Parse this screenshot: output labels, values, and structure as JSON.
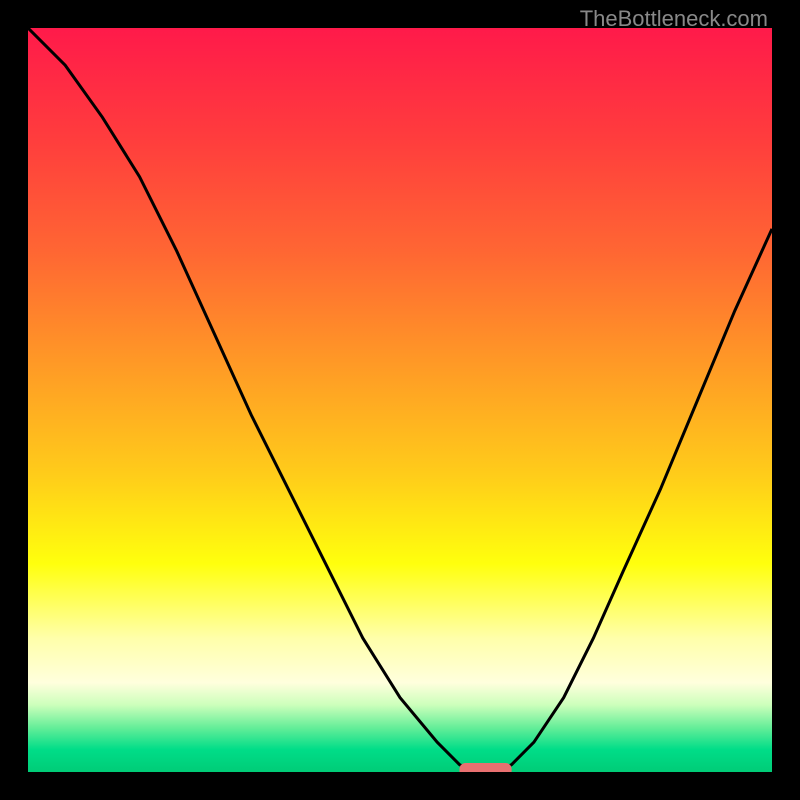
{
  "watermark": "TheBottleneck.com",
  "chart_data": {
    "type": "line",
    "title": "",
    "xlabel": "",
    "ylabel": "",
    "xlim": [
      0,
      100
    ],
    "ylim": [
      0,
      100
    ],
    "curve_points": [
      {
        "x": 0,
        "y": 100
      },
      {
        "x": 5,
        "y": 95
      },
      {
        "x": 10,
        "y": 88
      },
      {
        "x": 15,
        "y": 80
      },
      {
        "x": 20,
        "y": 70
      },
      {
        "x": 25,
        "y": 59
      },
      {
        "x": 30,
        "y": 48
      },
      {
        "x": 35,
        "y": 38
      },
      {
        "x": 40,
        "y": 28
      },
      {
        "x": 45,
        "y": 18
      },
      {
        "x": 50,
        "y": 10
      },
      {
        "x": 55,
        "y": 4
      },
      {
        "x": 58,
        "y": 1
      },
      {
        "x": 60,
        "y": 0
      },
      {
        "x": 63,
        "y": 0
      },
      {
        "x": 65,
        "y": 1
      },
      {
        "x": 68,
        "y": 4
      },
      {
        "x": 72,
        "y": 10
      },
      {
        "x": 76,
        "y": 18
      },
      {
        "x": 80,
        "y": 27
      },
      {
        "x": 85,
        "y": 38
      },
      {
        "x": 90,
        "y": 50
      },
      {
        "x": 95,
        "y": 62
      },
      {
        "x": 100,
        "y": 73
      }
    ],
    "marker": {
      "x_start": 58,
      "x_end": 65,
      "y": 0,
      "color": "#e87070"
    },
    "gradient_stops": [
      {
        "offset": 0,
        "color": "#ff1a4a"
      },
      {
        "offset": 15,
        "color": "#ff3d3d"
      },
      {
        "offset": 30,
        "color": "#ff6633"
      },
      {
        "offset": 45,
        "color": "#ff9926"
      },
      {
        "offset": 60,
        "color": "#ffcc1a"
      },
      {
        "offset": 72,
        "color": "#ffff0d"
      },
      {
        "offset": 82,
        "color": "#ffffaa"
      },
      {
        "offset": 88,
        "color": "#ffffdd"
      },
      {
        "offset": 91,
        "color": "#ccffbb"
      },
      {
        "offset": 94,
        "color": "#66ee99"
      },
      {
        "offset": 97,
        "color": "#00dd88"
      },
      {
        "offset": 100,
        "color": "#00cc77"
      }
    ]
  }
}
